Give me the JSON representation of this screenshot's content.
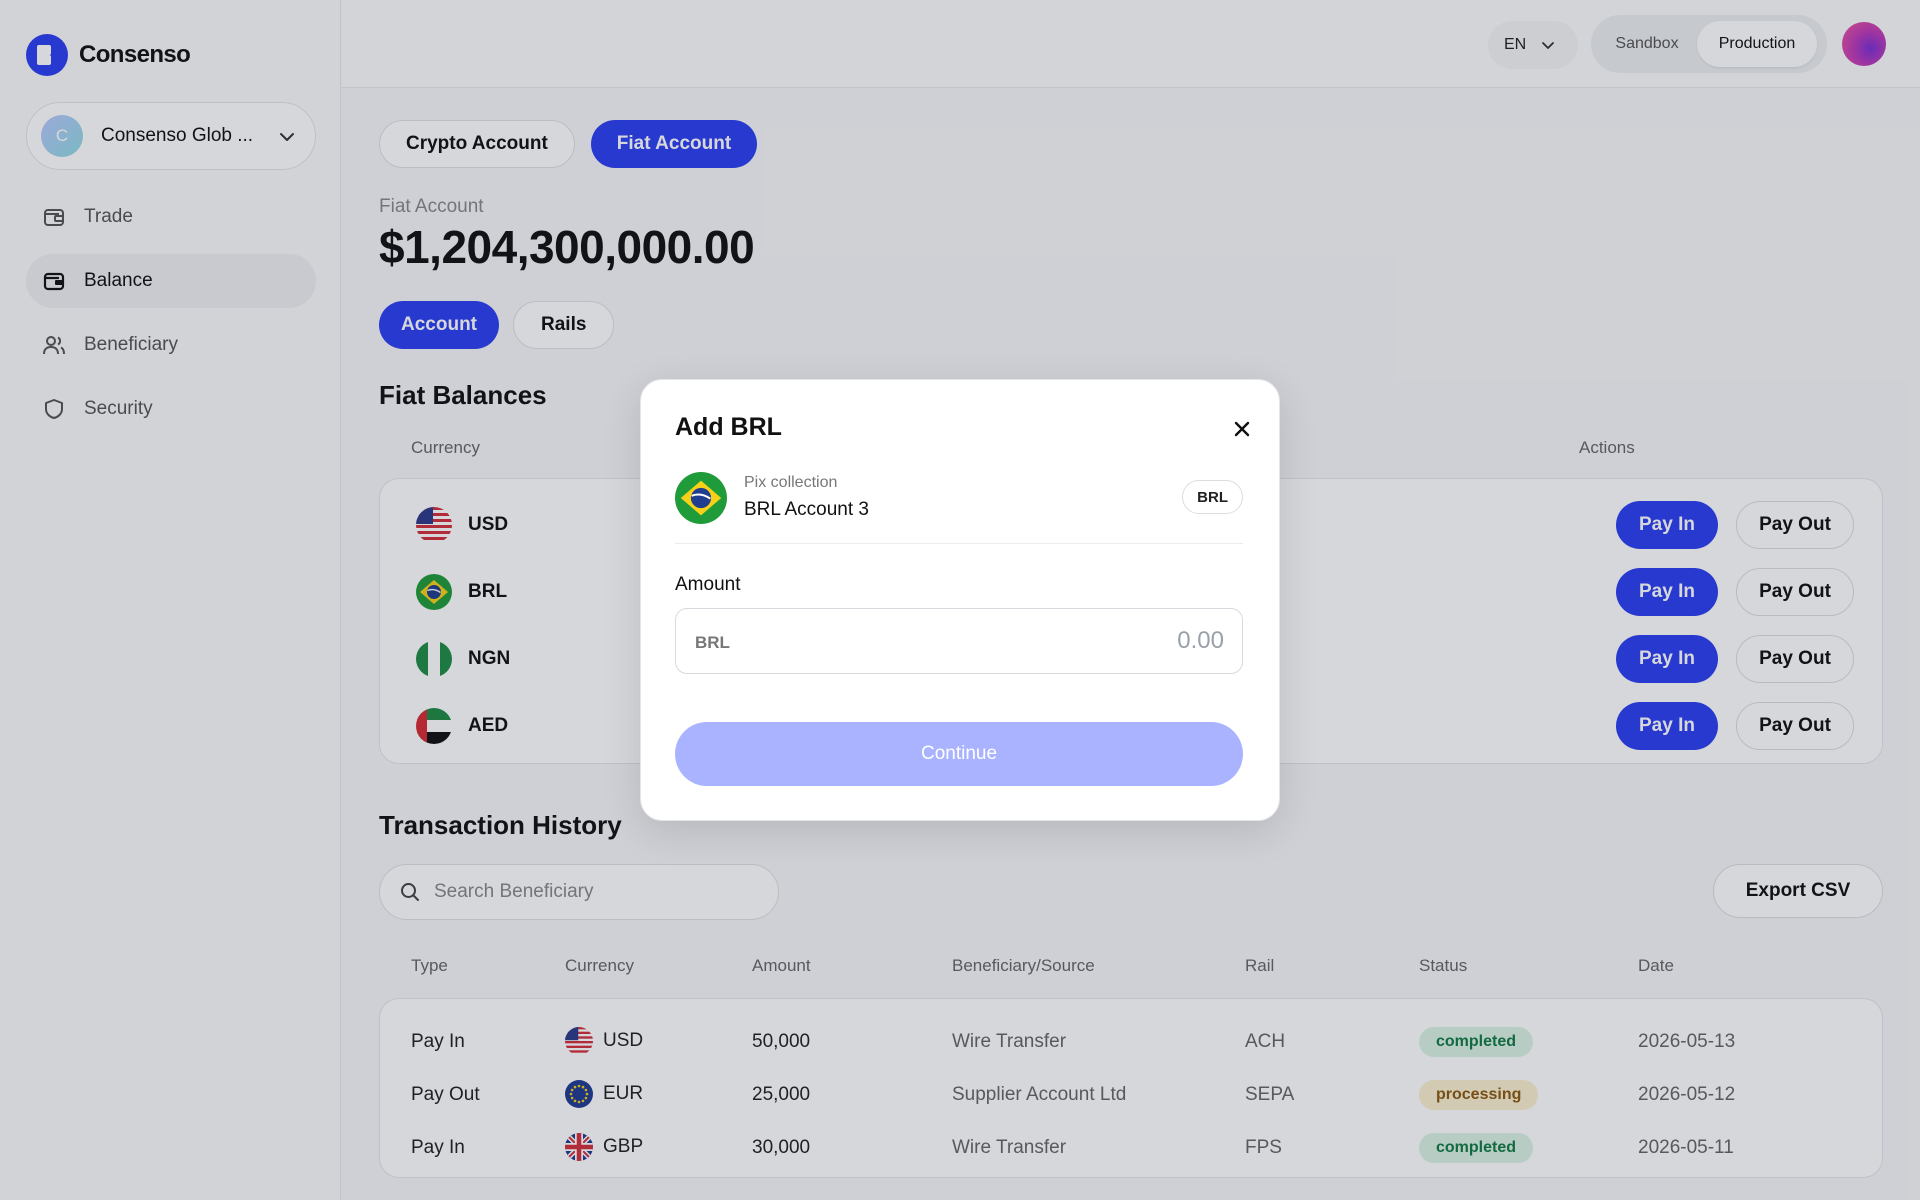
{
  "app": {
    "brand": "Consenso"
  },
  "sidebar": {
    "org": {
      "initial": "C",
      "name": "Consenso Glob ..."
    },
    "items": [
      {
        "label": "Trade",
        "icon": "wallet-icon"
      },
      {
        "label": "Balance",
        "icon": "wallet-icon"
      },
      {
        "label": "Beneficiary",
        "icon": "users-icon"
      },
      {
        "label": "Security",
        "icon": "shield-icon"
      }
    ],
    "active": "Balance"
  },
  "topbar": {
    "language": "EN",
    "env": {
      "sandbox": "Sandbox",
      "production": "Production",
      "selected": "Production"
    }
  },
  "account_tabs": {
    "crypto": "Crypto Account",
    "fiat": "Fiat Account",
    "selected": "Fiat Account"
  },
  "account": {
    "label": "Fiat Account",
    "total": "$1,204,300,000.00"
  },
  "sub_tabs": {
    "account": "Account",
    "rails": "Rails",
    "selected": "Account"
  },
  "balances": {
    "title": "Fiat Balances",
    "col_currency": "Currency",
    "col_actions": "Actions",
    "pay_in": "Pay In",
    "pay_out": "Pay Out",
    "rows": [
      {
        "code": "USD"
      },
      {
        "code": "BRL"
      },
      {
        "code": "NGN"
      },
      {
        "code": "AED"
      }
    ]
  },
  "history": {
    "title": "Transaction History",
    "search_placeholder": "Search Beneficiary",
    "export_label": "Export CSV",
    "columns": [
      "Type",
      "Currency",
      "Amount",
      "Beneficiary/Source",
      "Rail",
      "Status",
      "Date"
    ],
    "rows": [
      {
        "type": "Pay In",
        "currency": "USD",
        "amount": "50,000",
        "source": "Wire Transfer",
        "rail": "ACH",
        "status": "completed",
        "date": "2026-05-13"
      },
      {
        "type": "Pay Out",
        "currency": "EUR",
        "amount": "25,000",
        "source": "Supplier Account Ltd",
        "rail": "SEPA",
        "status": "processing",
        "date": "2026-05-12"
      },
      {
        "type": "Pay In",
        "currency": "GBP",
        "amount": "30,000",
        "source": "Wire Transfer",
        "rail": "FPS",
        "status": "completed",
        "date": "2026-05-11"
      }
    ]
  },
  "modal": {
    "title": "Add BRL",
    "method": "Pix collection",
    "account_name": "BRL Account 3",
    "currency_chip": "BRL",
    "amount_label": "Amount",
    "amount_prefix": "BRL",
    "amount_placeholder": "0.00",
    "continue_label": "Continue"
  },
  "colors": {
    "accent": "#2b3ff2",
    "continue_disabled": "#aab3ff",
    "completed_bg": "#d9f3e4",
    "processing_bg": "#fbefcf"
  }
}
